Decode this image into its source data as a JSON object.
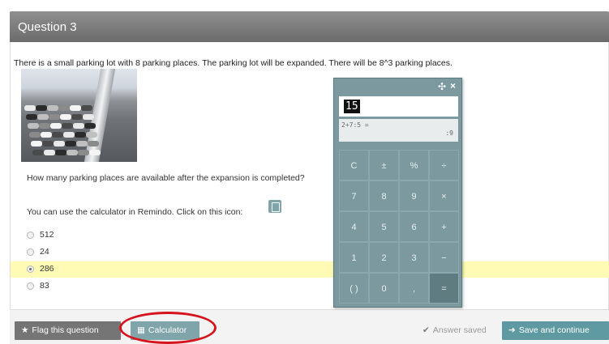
{
  "header": {
    "title": "Question 3"
  },
  "question": {
    "intro": "There is a small parking lot with 8 parking places. The parking lot will be expanded. There will be 8^3 parking places.",
    "text": "How many parking places are available after the expansion is completed?",
    "calculator_hint": "You can use the calculator in Remindo. Click on this icon:",
    "options": [
      {
        "label": "512",
        "selected": false
      },
      {
        "label": "24",
        "selected": false
      },
      {
        "label": "286",
        "selected": true
      },
      {
        "label": "83",
        "selected": false
      }
    ]
  },
  "calculator": {
    "display": "15",
    "history_expression": "2+7:5 =",
    "history_result": ":9",
    "keys": [
      [
        "C",
        "±",
        "%",
        "÷"
      ],
      [
        "7",
        "8",
        "9",
        "×"
      ],
      [
        "4",
        "5",
        "6",
        "+"
      ],
      [
        "1",
        "2",
        "3",
        "−"
      ],
      [
        "( )",
        "0",
        ",",
        "="
      ]
    ],
    "move_icon": "✣",
    "close_icon": "×"
  },
  "footer": {
    "flag_label": "Flag this question",
    "calculator_label": "Calculator",
    "status_text": "Answer saved",
    "save_label": "Save and continue"
  },
  "colors": {
    "header": "#7a7a7a",
    "accent": "#5f9aa3",
    "selected_row": "#fffbb5",
    "highlight_circle": "#d6141e",
    "calculator": "#7b999e"
  }
}
